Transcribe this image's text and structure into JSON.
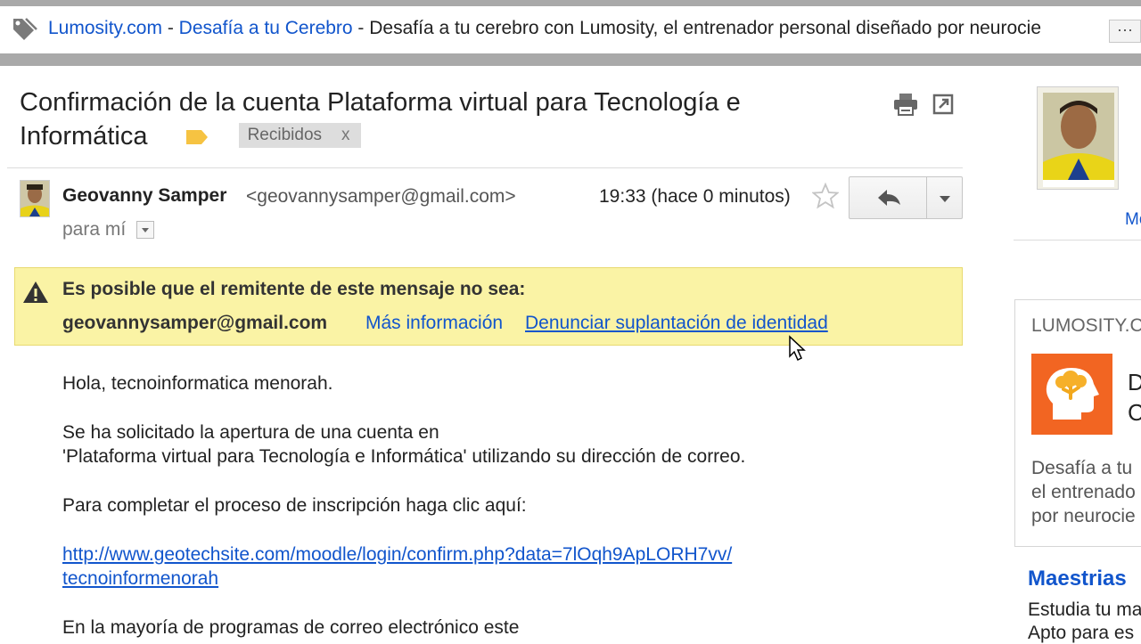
{
  "promo": {
    "site": "Lumosity.com",
    "sep1": " - ",
    "title": "Desafía a tu Cerebro",
    "sep2": " - ",
    "description": "Desafía a tu cerebro con Lumosity, el entrenador personal diseñado por neurocie",
    "more_label": "···"
  },
  "email": {
    "subject": "Confirmación de la cuenta Plataforma virtual para Tecnología e Informática",
    "label_color": "#f6c342",
    "inbox_chip": "Recibidos",
    "inbox_chip_close": "x",
    "sender_name": "Geovanny Samper",
    "sender_email": "<geovannysamper@gmail.com>",
    "timestamp": "19:33 (hace 0 minutos)",
    "to_me": "para mí"
  },
  "warning": {
    "title": "Es posible que el remitente de este mensaje no sea:",
    "email": "geovannysamper@gmail.com",
    "more_info": "Más información",
    "report": "Denunciar suplantación de identidad",
    "background": "#faf3a5"
  },
  "body": {
    "greeting": "Hola, tecnoinformatica menorah.",
    "line1": "Se ha solicitado la apertura de una cuenta en",
    "line2": "'Plataforma virtual para Tecnología e Informática' utilizando su dirección de correo.",
    "line3": "Para completar el proceso de inscripción haga clic aquí:",
    "link1": "http://www.geotechsite.com/moodle/login/confirm.php?data=7lOqh9ApLORH7vv/",
    "link2": "tecnoinformenorah",
    "line4": "En la mayoría de programas de correo electrónico este"
  },
  "sidebar": {
    "more_link": "Mo",
    "ad": {
      "domain": "LUMOSITY.C",
      "headline_1": "D",
      "headline_2": "C",
      "desc_1": "Desafía a tu",
      "desc_2": "el entrenado",
      "desc_3": "por neurocie",
      "logo_color": "#f26522"
    },
    "ad2": {
      "title": "Maestrias",
      "line1": "Estudia tu ma",
      "line2": "Apto para es"
    }
  },
  "icons": [
    "tag-icon",
    "print-icon",
    "new-window-icon",
    "star-icon",
    "reply-icon",
    "chevron-down-icon",
    "warning-icon",
    "cursor-icon",
    "head-tree-icon"
  ],
  "colors": {
    "link": "#1155cc",
    "accent_orange": "#f26522"
  }
}
